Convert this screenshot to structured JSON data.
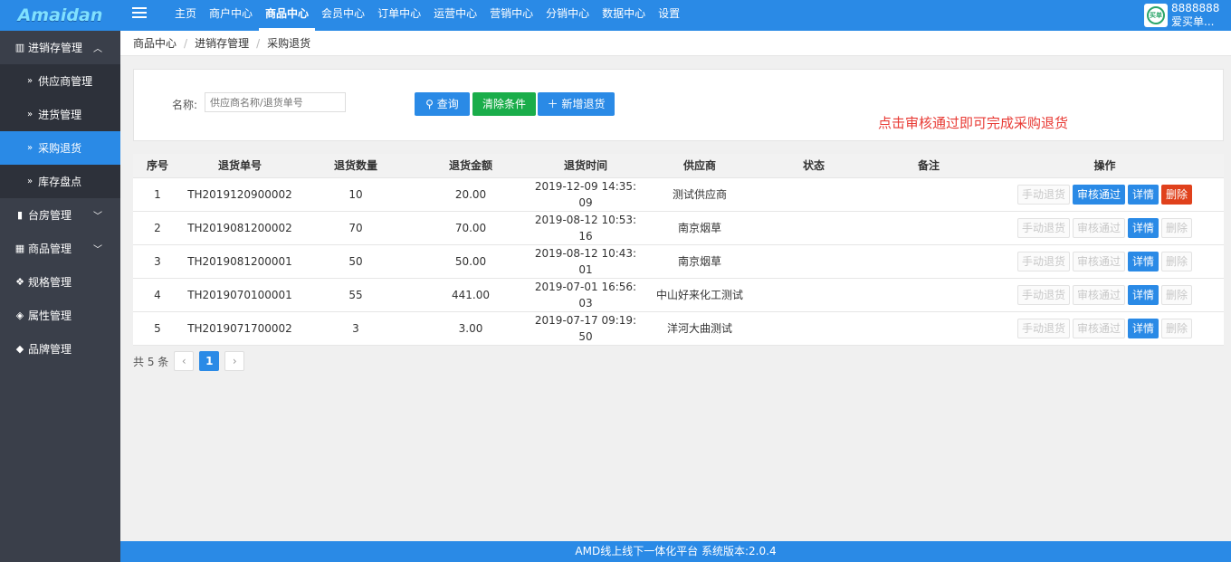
{
  "header": {
    "logo": "Amaidan",
    "nav": [
      "主页",
      "商户中心",
      "商品中心",
      "会员中心",
      "订单中心",
      "运营中心",
      "营销中心",
      "分销中心",
      "数据中心",
      "设置"
    ],
    "active_nav": "商品中心",
    "user_id": "8888888...",
    "user_name": "爱买单..."
  },
  "sidebar": {
    "group_open": {
      "icon": "map-icon",
      "label": "进销存管理"
    },
    "sub_items": [
      {
        "label": "供应商管理",
        "active": false
      },
      {
        "label": "进货管理",
        "active": false
      },
      {
        "label": "采购退货",
        "active": true
      },
      {
        "label": "库存盘点",
        "active": false
      }
    ],
    "groups": [
      {
        "icon": "bookmark-icon",
        "label": "台房管理",
        "expandable": true
      },
      {
        "icon": "grid-icon",
        "label": "商品管理",
        "expandable": true
      },
      {
        "icon": "cubes-icon",
        "label": "规格管理",
        "expandable": false
      },
      {
        "icon": "cube-icon",
        "label": "属性管理",
        "expandable": false
      },
      {
        "icon": "tags-icon",
        "label": "品牌管理",
        "expandable": false
      }
    ]
  },
  "breadcrumb": [
    "商品中心",
    "进销存管理",
    "采购退货"
  ],
  "filter": {
    "name_label": "名称:",
    "name_placeholder": "供应商名称/退货单号",
    "search_label": "查询",
    "clear_label": "清除条件",
    "add_label": "新增退货",
    "hint": "点击审核通过即可完成采购退货"
  },
  "table": {
    "columns": [
      "序号",
      "退货单号",
      "退货数量",
      "退货金额",
      "退货时间",
      "供应商",
      "状态",
      "备注",
      "操作"
    ],
    "op_labels": {
      "manual": "手动退货",
      "approve": "审核通过",
      "detail": "详情",
      "delete": "删除"
    },
    "rows": [
      {
        "no": "1",
        "order": "TH2019120900002",
        "qty": "10",
        "amount": "20.00",
        "time_a": "2019-12-09 14:35:",
        "time_b": "09",
        "supplier": "测试供应商",
        "status": "",
        "remark": "",
        "approve_enabled": true,
        "delete_enabled": true
      },
      {
        "no": "2",
        "order": "TH2019081200002",
        "qty": "70",
        "amount": "70.00",
        "time_a": "2019-08-12 10:53:",
        "time_b": "16",
        "supplier": "南京烟草",
        "status": "",
        "remark": "",
        "approve_enabled": false,
        "delete_enabled": false
      },
      {
        "no": "3",
        "order": "TH2019081200001",
        "qty": "50",
        "amount": "50.00",
        "time_a": "2019-08-12 10:43:",
        "time_b": "01",
        "supplier": "南京烟草",
        "status": "",
        "remark": "",
        "approve_enabled": false,
        "delete_enabled": false
      },
      {
        "no": "4",
        "order": "TH2019070100001",
        "qty": "55",
        "amount": "441.00",
        "time_a": "2019-07-01 16:56:",
        "time_b": "03",
        "supplier": "中山好来化工测试",
        "status": "",
        "remark": "",
        "approve_enabled": false,
        "delete_enabled": false
      },
      {
        "no": "5",
        "order": "TH2019071700002",
        "qty": "3",
        "amount": "3.00",
        "time_a": "2019-07-17 09:19:",
        "time_b": "50",
        "supplier": "洋河大曲测试",
        "status": "",
        "remark": "",
        "approve_enabled": false,
        "delete_enabled": false
      }
    ]
  },
  "pager": {
    "total": "共 5 条",
    "current": "1",
    "prev": "‹",
    "next": "›"
  },
  "footer": "AMD线上线下一体化平台 系统版本:2.0.4",
  "colors": {
    "primary": "#2a8ae6",
    "success": "#1aad4a",
    "danger": "#e0411c",
    "sidebar": "#3a3f4a",
    "hint": "#e83a34"
  }
}
